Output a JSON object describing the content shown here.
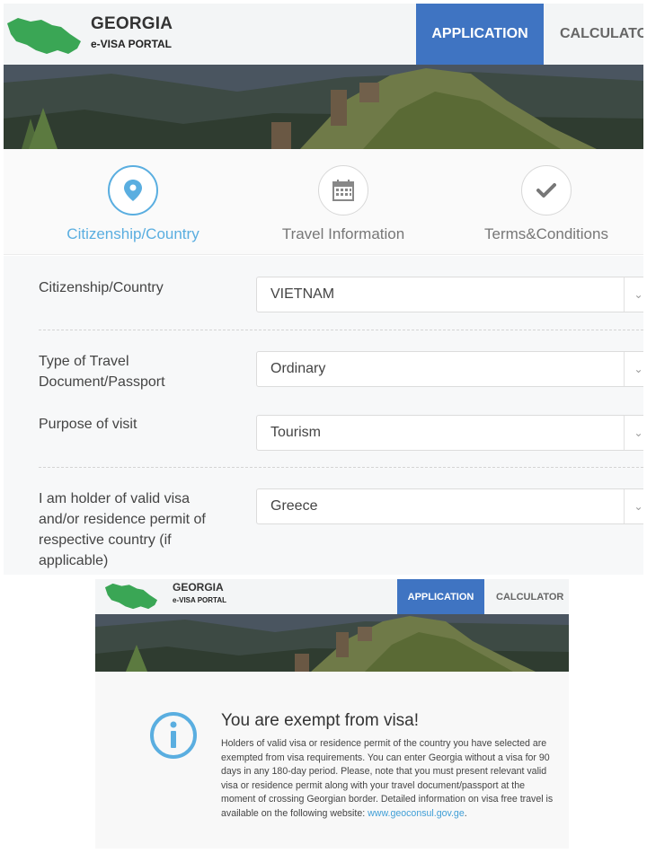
{
  "top": {
    "header": {
      "brand_title": "GEORGIA",
      "brand_subtitle": "e-VISA PORTAL",
      "nav_application": "APPLICATION",
      "nav_calculator": "CALCULATO"
    },
    "steps": [
      {
        "label": "Citizenship/Country",
        "icon": "location-pin-icon",
        "active": true
      },
      {
        "label": "Travel Information",
        "icon": "calendar-icon",
        "active": false
      },
      {
        "label": "Terms&Conditions",
        "icon": "checkmark-icon",
        "active": false
      }
    ],
    "form": {
      "citizenship_label": "Citizenship/Country",
      "citizenship_value": "VIETNAM",
      "doc_type_label_1": "Type of Travel",
      "doc_type_label_2": "Document/Passport",
      "doc_type_value": "Ordinary",
      "purpose_label": "Purpose of visit",
      "purpose_value": "Tourism",
      "holder_label_1": "I am holder of valid visa",
      "holder_label_2": "and/or residence permit of",
      "holder_label_3": "respective country (if",
      "holder_label_4": "applicable)",
      "holder_value": "Greece"
    }
  },
  "bottom": {
    "header": {
      "brand_title": "GEORGIA",
      "brand_subtitle": "e-VISA PORTAL",
      "nav_application": "APPLICATION",
      "nav_calculator": "CALCULATOR"
    },
    "message": {
      "title": "You are exempt from visa!",
      "body": "Holders of valid visa or residence permit of the country you have selected are exempted from visa requirements. You can enter Georgia without a visa for 90 days in any 180-day period. Please, note that you must present relevant valid visa or residence permit along with your travel document/passport at the moment of crossing Georgian border. Detailed information on visa free travel is available on the following website:",
      "link": "www.geoconsul.gov.ge",
      "link_suffix": "."
    }
  },
  "colors": {
    "accent_blue": "#3f74c2",
    "active_step": "#5aaee0",
    "map_green": "#3aa655",
    "link": "#3f9ed6"
  }
}
